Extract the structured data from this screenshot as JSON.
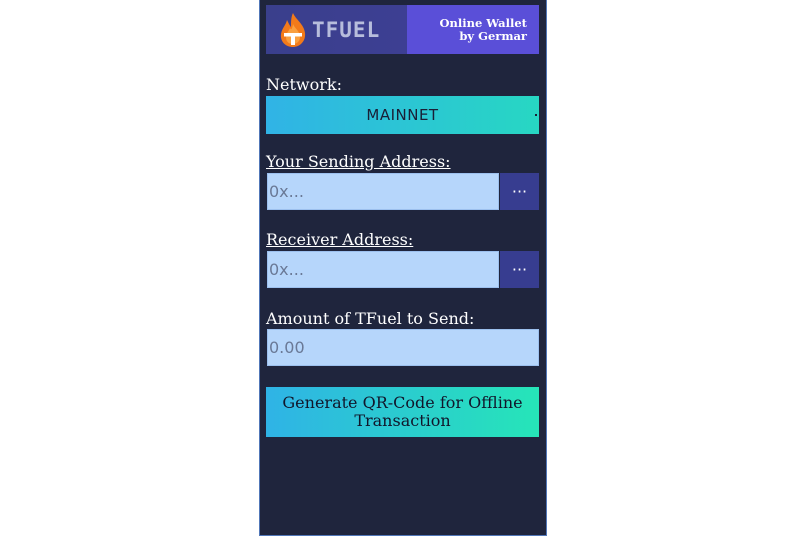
{
  "header": {
    "brand": "TFUEL",
    "tagline_line1": "Online Wallet",
    "tagline_line2": "by Germar"
  },
  "network": {
    "label": "Network:",
    "value": "MAINNET"
  },
  "sending_address": {
    "label": "Your Sending Address:",
    "placeholder": "0x...",
    "dots": "···"
  },
  "receiver_address": {
    "label": "Receiver Address:",
    "placeholder": "0x...",
    "dots": "···"
  },
  "amount": {
    "label": "Amount of TFuel to Send:",
    "placeholder": "0.00"
  },
  "generate_button": {
    "label": "Generate QR-Code for Offline Transaction"
  },
  "colors": {
    "panel_bg": "#1f253d",
    "header_left": "#3a3f8c",
    "header_right": "#5a4fd8",
    "gradient_start": "#30b3e6",
    "gradient_end": "#26e5b8",
    "input_bg": "#b6d6fb",
    "dots_button": "#373d90"
  },
  "icons": {
    "logo": "tfuel-flame-icon",
    "more": "ellipsis-icon"
  }
}
